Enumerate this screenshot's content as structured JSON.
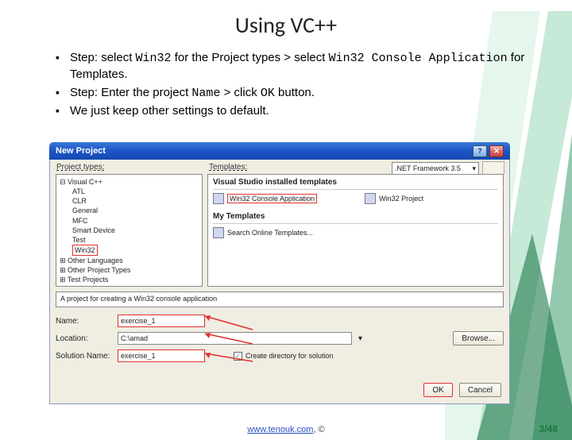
{
  "slide": {
    "title": "Using VC++",
    "bullets": [
      {
        "prefix": "Step: select ",
        "code1": "Win32",
        "mid1": " for the Project types > select ",
        "code2": "Win32 Console Application",
        "mid2": " for Templates."
      },
      {
        "prefix": "Step: Enter the project ",
        "code1": "Name",
        "mid1": " > click ",
        "code2": "OK",
        "mid2": " button."
      },
      {
        "prefix": "We just keep other settings to default.",
        "code1": "",
        "mid1": "",
        "code2": "",
        "mid2": ""
      }
    ]
  },
  "dialog": {
    "title": "New Project",
    "help": "?",
    "close": "✕",
    "labels": {
      "project_types": "Project types:",
      "templates": "Templates:",
      "framework": ".NET Framework 3.5"
    },
    "tree": {
      "root": "Visual C++",
      "children": [
        "ATL",
        "CLR",
        "General",
        "MFC",
        "Smart Device",
        "Test"
      ],
      "selected": "Win32",
      "others": [
        "Other Languages",
        "Other Project Types",
        "Test Projects"
      ]
    },
    "templates_section": {
      "header1": "Visual Studio installed templates",
      "item_selected": "Win32 Console Application",
      "item_other": "Win32 Project",
      "header2": "My Templates",
      "item_search": "Search Online Templates..."
    },
    "description": "A project for creating a Win32 console application",
    "form": {
      "name_label": "Name:",
      "name_value": "exercise_1",
      "location_label": "Location:",
      "location_value": "C:\\amad",
      "location_browse": "Browse...",
      "solution_label": "Solution Name:",
      "solution_value": "exercise_1",
      "create_dir": "Create directory for solution"
    },
    "buttons": {
      "ok": "OK",
      "cancel": "Cancel"
    }
  },
  "footer": {
    "url": "www.tenouk.com",
    "copy": ", ©"
  },
  "pagenum": "3/48"
}
